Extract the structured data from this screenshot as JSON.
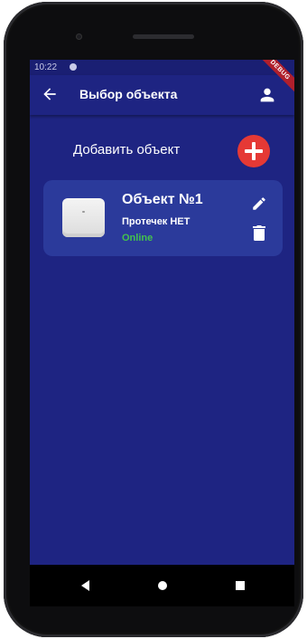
{
  "status_bar": {
    "time": "10:22"
  },
  "debug_banner": "DEBUG",
  "app_bar": {
    "title": "Выбор объекта"
  },
  "add_object": {
    "label": "Добавить объект"
  },
  "objects": [
    {
      "name": "Объект №1",
      "leak_status": "Протечек НЕТ",
      "connection": "Online"
    }
  ],
  "colors": {
    "background": "#1e2482",
    "card": "#2b3a9b",
    "add_button": "#e53935",
    "online": "#43c24d"
  },
  "icons": [
    "back-arrow-icon",
    "user-icon",
    "plus-icon",
    "edit-pencil-icon",
    "trash-icon",
    "nav-back-icon",
    "nav-home-icon",
    "nav-recent-icon"
  ]
}
